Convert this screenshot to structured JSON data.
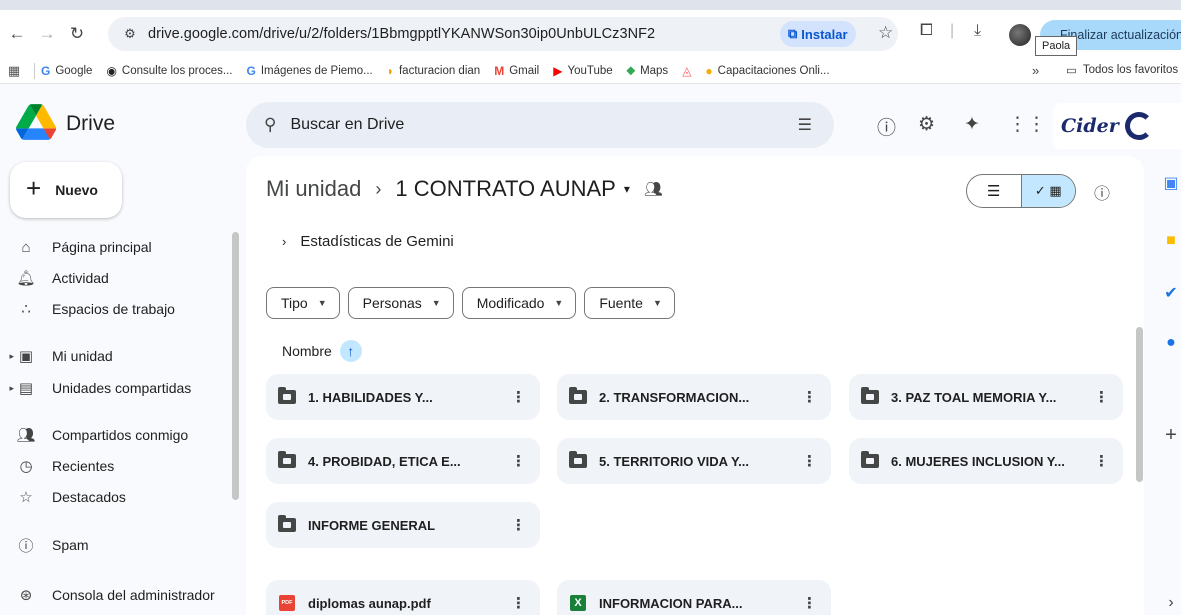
{
  "browser": {
    "url": "drive.google.com/drive/u/2/folders/1BbmgpptlYKANWSon30ip0UnbULCz3NF2",
    "install_label": "Instalar",
    "update_label": "Finalizar actualización",
    "profile_tooltip": "Paola",
    "bookmarks": [
      {
        "label": "Google",
        "icon": "google-icon",
        "color": "#4285f4"
      },
      {
        "label": "Consulte los proces...",
        "icon": "globe-icon",
        "color": "#202124"
      },
      {
        "label": "Imágenes de Piemo...",
        "icon": "google-icon",
        "color": "#4285f4"
      },
      {
        "label": "facturacion dian",
        "icon": "dian-icon",
        "color": "#f29900"
      },
      {
        "label": "Gmail",
        "icon": "gmail-icon",
        "color": "#ea4335"
      },
      {
        "label": "YouTube",
        "icon": "youtube-icon",
        "color": "#ff0000"
      },
      {
        "label": "Maps",
        "icon": "maps-pin-icon",
        "color": "#34a853"
      },
      {
        "label": "",
        "icon": "airbnb-icon",
        "color": "#ff5a5f"
      },
      {
        "label": "Capacitaciones Onli...",
        "icon": "course-icon",
        "color": "#f9ab00"
      }
    ],
    "all_bookmarks_label": "Todos los favoritos"
  },
  "drive": {
    "app_name": "Drive",
    "search_placeholder": "Buscar en Drive",
    "new_button": "Nuevo"
  },
  "sidebar": {
    "items": [
      {
        "label": "Página principal",
        "icon": "home-icon"
      },
      {
        "label": "Actividad",
        "icon": "bell-icon"
      },
      {
        "label": "Espacios de trabajo",
        "icon": "workspaces-icon"
      },
      {
        "label": "Mi unidad",
        "icon": "my-drive-icon"
      },
      {
        "label": "Unidades compartidas",
        "icon": "shared-drives-icon"
      },
      {
        "label": "Compartidos conmigo",
        "icon": "people-icon"
      },
      {
        "label": "Recientes",
        "icon": "clock-icon"
      },
      {
        "label": "Destacados",
        "icon": "star-icon"
      },
      {
        "label": "Spam",
        "icon": "spam-icon"
      },
      {
        "label": "Consola del administrador",
        "icon": "admin-icon"
      }
    ]
  },
  "main": {
    "breadcrumb": {
      "root": "Mi unidad",
      "current": "1 CONTRATO AUNAP"
    },
    "gemini_label": "Estadísticas de Gemini",
    "filters": [
      "Tipo",
      "Personas",
      "Modificado",
      "Fuente"
    ],
    "sort_label": "Nombre",
    "folders": [
      {
        "name": "1. HABILIDADES Y..."
      },
      {
        "name": "2. TRANSFORMACION..."
      },
      {
        "name": "3. PAZ TOAL MEMORIA Y..."
      },
      {
        "name": "4. PROBIDAD, ETICA E..."
      },
      {
        "name": "5. TERRITORIO VIDA Y..."
      },
      {
        "name": "6. MUJERES INCLUSION Y..."
      },
      {
        "name": "INFORME GENERAL"
      }
    ],
    "files": [
      {
        "name": "diplomas aunap.pdf",
        "type": "pdf",
        "badge": "PDF"
      },
      {
        "name": "INFORMACION PARA...",
        "type": "sheet",
        "badge": "X"
      }
    ]
  },
  "colors": {
    "accent": "#0b57d0",
    "selected_chip": "#c2e7ff",
    "tile_bg": "#f0f4f9"
  }
}
